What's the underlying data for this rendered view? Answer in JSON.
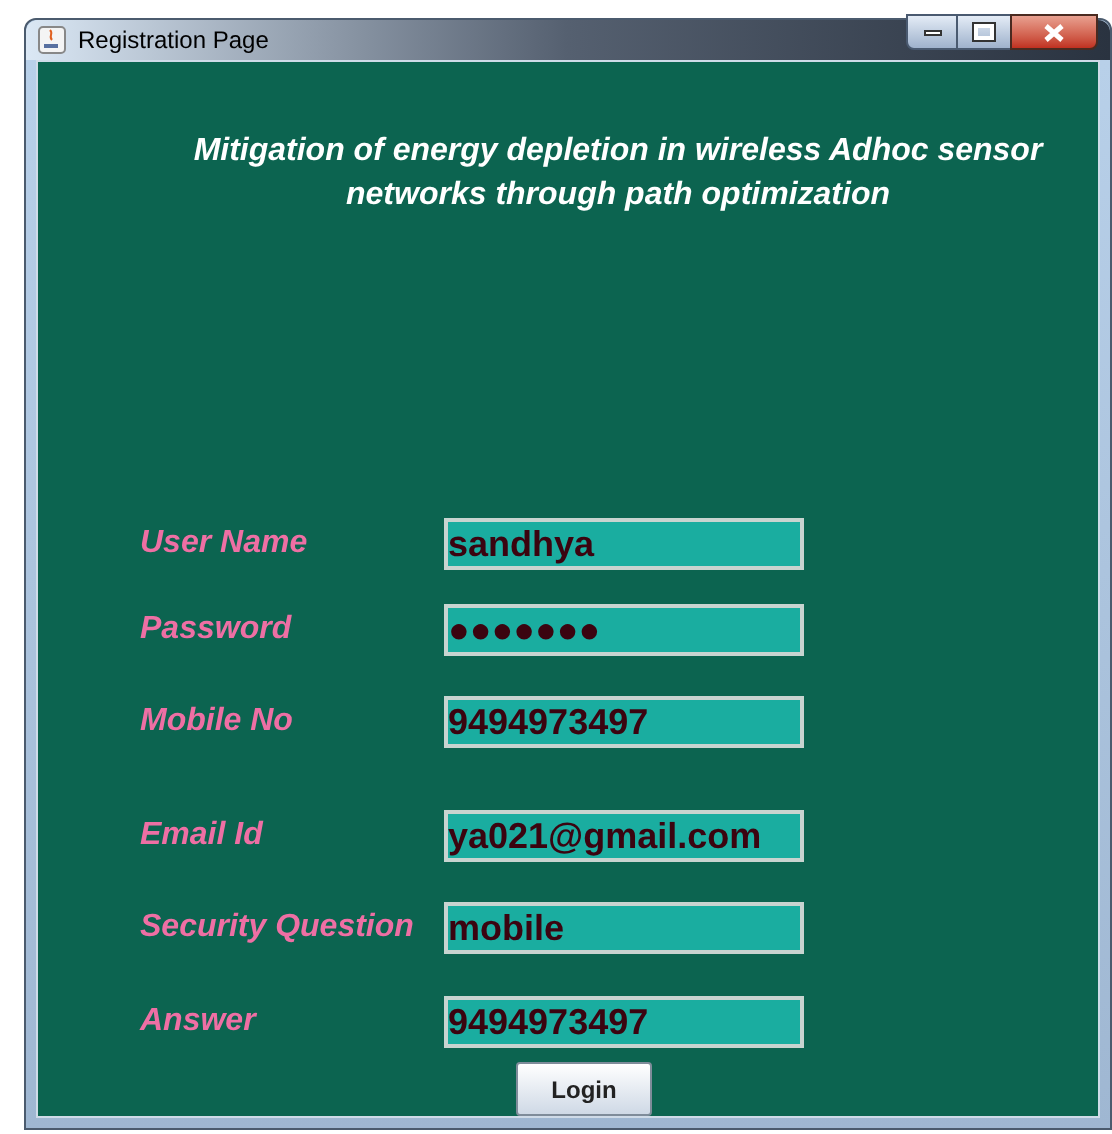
{
  "window": {
    "title": "Registration Page"
  },
  "heading": "Mitigation of energy depletion in wireless Adhoc sensor networks through path optimization",
  "fields": [
    {
      "label": "User Name",
      "value": "sandhya"
    },
    {
      "label": "Password",
      "value": "●●●●●●●"
    },
    {
      "label": "Mobile No",
      "value": "9494973497"
    },
    {
      "label": "Email Id",
      "value": "ya021@gmail.com"
    },
    {
      "label": "Security Question",
      "value": "mobile"
    },
    {
      "label": "Answer",
      "value": "9494973497"
    }
  ],
  "button": "Login"
}
